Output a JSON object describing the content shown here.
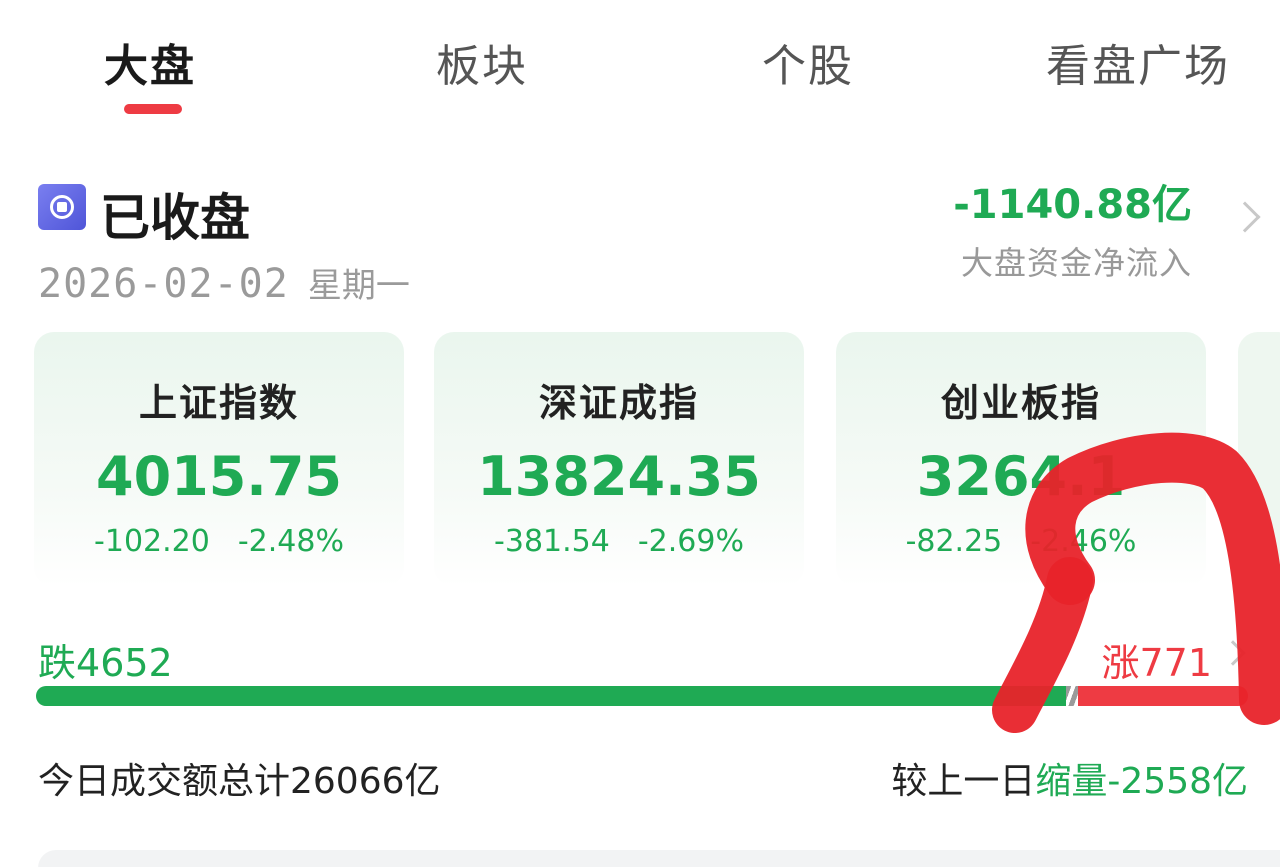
{
  "tabs": [
    {
      "label": "大盘",
      "active": true
    },
    {
      "label": "板块",
      "active": false
    },
    {
      "label": "个股",
      "active": false
    },
    {
      "label": "看盘广场",
      "active": false
    }
  ],
  "market_status": {
    "status": "已收盘",
    "date": "2026-02-02",
    "weekday": "星期一"
  },
  "capital_flow": {
    "value": "-1140.88亿",
    "label": "大盘资金净流入"
  },
  "indices": [
    {
      "name": "上证指数",
      "value": "4015.75",
      "change": "-102.20",
      "change_pct": "-2.48%"
    },
    {
      "name": "深证成指",
      "value": "13824.35",
      "change": "-381.54",
      "change_pct": "-2.69%"
    },
    {
      "name": "创业板指",
      "value": "3264.1",
      "change": "-82.25",
      "change_pct": "-2.46%"
    }
  ],
  "breadth": {
    "down_label": "跌",
    "down_count": "4652",
    "up_label": "涨",
    "up_count": "771",
    "down_fraction": 0.85,
    "flat_fraction": 0.01,
    "up_fraction": 0.14
  },
  "turnover": {
    "text": "今日成交额总计26066亿",
    "compare_prefix": "较上一日",
    "compare_value": "缩量-2558亿"
  },
  "colors": {
    "up": "#ee3b43",
    "down": "#1faa54",
    "annotation": "#e8232a"
  }
}
